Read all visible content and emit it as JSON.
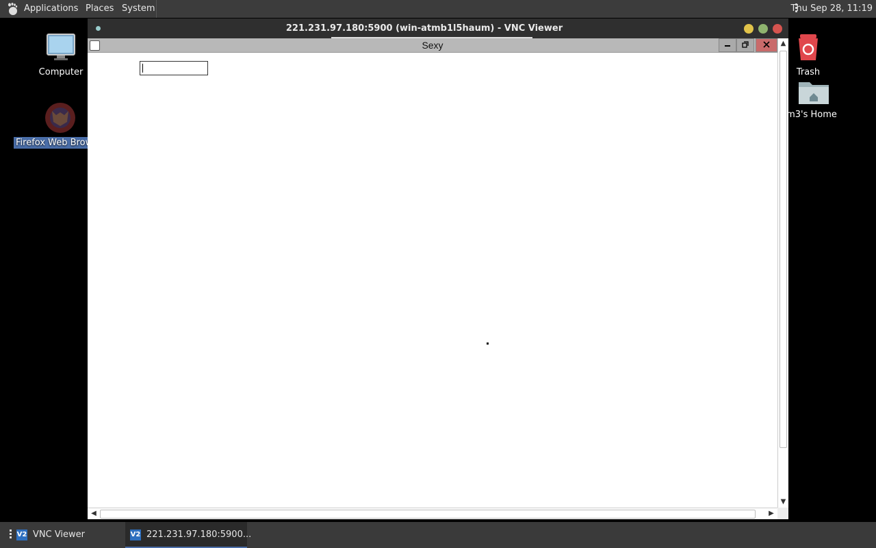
{
  "top_panel": {
    "applications": "Applications",
    "places": "Places",
    "system": "System",
    "clock": "Thu Sep 28, 11:19"
  },
  "desktop": {
    "computer": "Computer",
    "firefox": "Firefox Web Brow",
    "trash": "Trash",
    "home": "m3's Home"
  },
  "vnc": {
    "title": "221.231.97.180:5900 (win-atmb1l5haum) - VNC Viewer",
    "remote_title": "Sexy",
    "remote_input_value": ""
  },
  "taskbar": {
    "vnc_viewer": "VNC Viewer",
    "remote_session": "221.231.97.180:5900..."
  },
  "colors": {
    "panel": "#3c3c3c",
    "accent": "#4a6ea9",
    "close": "#d5544f",
    "minimize": "#e1c34a",
    "maximize": "#8fb36e"
  }
}
